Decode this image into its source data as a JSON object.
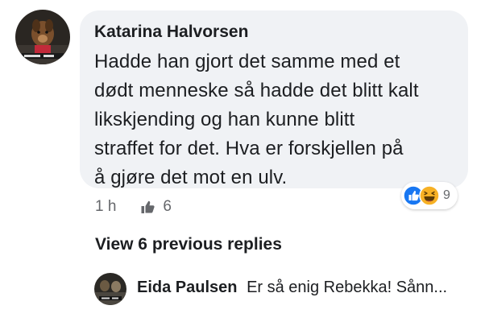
{
  "comment": {
    "author": "Katarina Halvorsen",
    "lines": [
      "Hadde han gjort det samme med et",
      "dødt menneske så hadde det blitt kalt",
      "likskjending og han kunne blitt",
      "straffet for det. Hva er forskjellen på",
      "å gjøre det mot en ulv."
    ],
    "time": "1 h",
    "likes": "6",
    "reactions": {
      "icons": [
        "like-icon",
        "haha-icon"
      ],
      "count": "9"
    }
  },
  "view_replies_label": "View 6 previous replies",
  "reply": {
    "author": "Eida Paulsen",
    "text": "Er så enig Rebekka! Sånn..."
  },
  "colors": {
    "bubble_bg": "#f0f2f5",
    "like_blue": "#1877f2",
    "haha_yellow": "#f7b125",
    "meta_gray": "#65676b"
  }
}
